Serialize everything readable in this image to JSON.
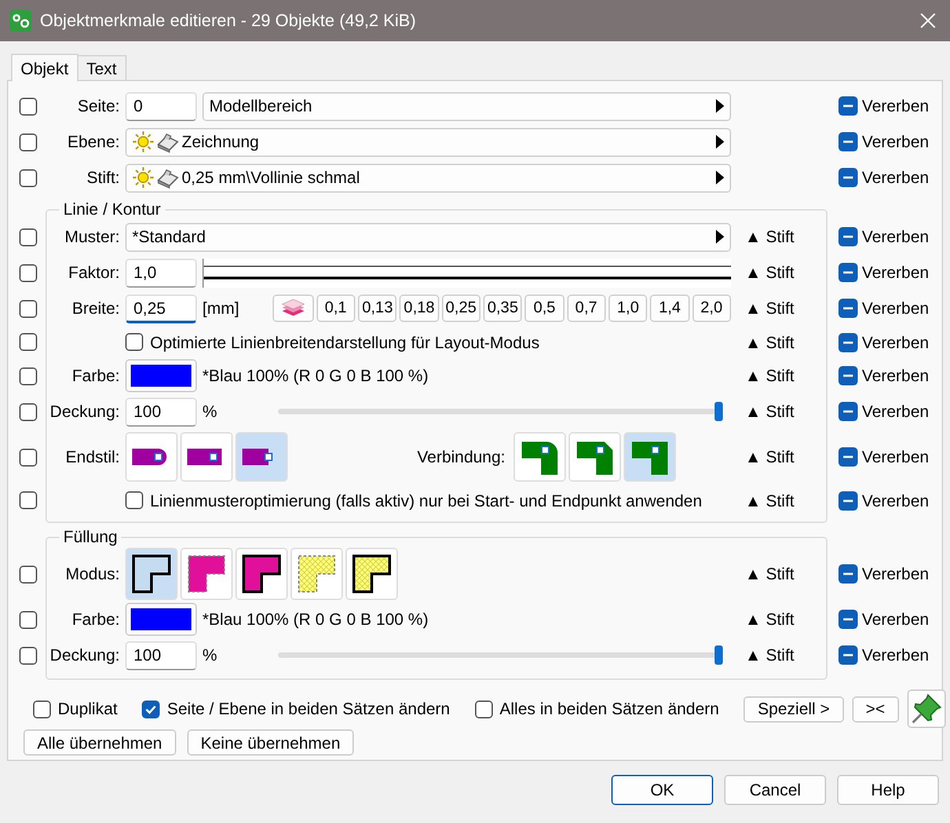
{
  "window": {
    "title": "Objektmerkmale editieren - 29 Objekte (49,2 KiB)"
  },
  "tabs": [
    {
      "label": "Objekt",
      "selected": true
    },
    {
      "label": "Text",
      "selected": false
    }
  ],
  "sections": [
    {
      "rows": [
        {
          "kind": "dropdown",
          "checked": false,
          "label": "Seite:",
          "value": "0",
          "choice": "Modellbereich",
          "icons": false,
          "inherit": "Vererben"
        },
        {
          "kind": "dropdown",
          "checked": false,
          "label": "Ebene:",
          "choice": "Zeichnung",
          "icons": true,
          "inherit": "Vererben"
        },
        {
          "kind": "dropdown",
          "checked": false,
          "label": "Stift:",
          "choice": "0,25 mm\\Vollinie schmal",
          "icons": true,
          "inherit": "Vererben"
        }
      ]
    },
    {
      "title": "Linie / Kontur",
      "rows": [
        {
          "kind": "dropdown",
          "checked": false,
          "label": "Muster:",
          "choice": "*Standard",
          "icons": false,
          "pen": "▲ Stift",
          "inherit": "Vererben"
        },
        {
          "kind": "factor",
          "checked": false,
          "label": "Faktor:",
          "value": "1,0",
          "pen": "▲ Stift",
          "inherit": "Vererben"
        },
        {
          "kind": "width",
          "checked": false,
          "label": "Breite:",
          "value": "0,25",
          "focused": true,
          "unit": "[mm]",
          "presets": [
            "0,1",
            "0,13",
            "0,18",
            "0,25",
            "0,35",
            "0,5",
            "0,7",
            "1,0",
            "1,4",
            "2,0"
          ],
          "pen": "▲ Stift",
          "inherit": "Vererben"
        },
        {
          "kind": "option",
          "checked": false,
          "option": "Optimierte Linienbreitendarstellung für Layout-Modus",
          "option_checked": false,
          "pen": "▲ Stift",
          "inherit": "Vererben"
        },
        {
          "kind": "color",
          "checked": false,
          "label": "Farbe:",
          "color": "#0000ff",
          "color_name": "*Blau 100% (R 0 G 0 B 100 %)",
          "pen": "▲ Stift",
          "inherit": "Vererben"
        },
        {
          "kind": "opacity",
          "checked": false,
          "label": "Deckung:",
          "value": "100",
          "unit": "%",
          "level": 1,
          "pen": "▲ Stift",
          "inherit": "Vererben"
        },
        {
          "kind": "styles",
          "checked": false,
          "label": "Endstil:",
          "groups": [
            {
              "items": [
                {
                  "kind": "cap-round",
                  "selected": false
                },
                {
                  "kind": "cap-square",
                  "selected": false
                },
                {
                  "kind": "cap-flat",
                  "selected": true
                }
              ]
            },
            {
              "label": "Verbindung:",
              "items": [
                {
                  "kind": "join-round",
                  "selected": false
                },
                {
                  "kind": "join-bevel",
                  "selected": false
                },
                {
                  "kind": "join-miter",
                  "selected": true
                }
              ]
            }
          ],
          "pen": "▲ Stift",
          "inherit": "Vererben"
        },
        {
          "kind": "option",
          "checked": false,
          "option": "Linienmusteroptimierung (falls aktiv) nur bei Start- und Endpunkt anwenden",
          "option_checked": false,
          "pen": "▲ Stift",
          "inherit": "Vererben"
        }
      ]
    },
    {
      "title": "Füllung",
      "rows": [
        {
          "kind": "styles",
          "checked": false,
          "label": "Modus:",
          "groups": [
            {
              "items": [
                {
                  "kind": "fill-outline",
                  "selected": true
                },
                {
                  "kind": "fill-solid",
                  "selected": false
                },
                {
                  "kind": "fill-solid-border",
                  "selected": false
                },
                {
                  "kind": "fill-hatch",
                  "selected": false
                },
                {
                  "kind": "fill-hatch-border",
                  "selected": false
                }
              ]
            }
          ],
          "pen": "▲ Stift",
          "inherit": "Vererben"
        },
        {
          "kind": "color",
          "checked": false,
          "label": "Farbe:",
          "color": "#0000ff",
          "color_name": "*Blau 100% (R 0 G 0 B 100 %)",
          "pen": "▲ Stift",
          "inherit": "Vererben"
        },
        {
          "kind": "opacity",
          "checked": false,
          "label": "Deckung:",
          "value": "100",
          "unit": "%",
          "level": 1,
          "pen": "▲ Stift",
          "inherit": "Vererben"
        }
      ]
    }
  ],
  "options": [
    {
      "label": "Duplikat",
      "checked": false
    },
    {
      "label": "Seite / Ebene in beiden Sätzen ändern",
      "checked": true
    },
    {
      "label": "Alles in beiden Sätzen ändern",
      "checked": false
    }
  ],
  "option_buttons": [
    "Speziell >",
    "><"
  ],
  "apply_buttons": [
    "Alle übernehmen",
    "Keine übernehmen"
  ],
  "dialog_buttons": [
    {
      "label": "OK",
      "default": true
    },
    {
      "label": "Cancel",
      "default": false
    },
    {
      "label": "Help",
      "default": false
    }
  ]
}
